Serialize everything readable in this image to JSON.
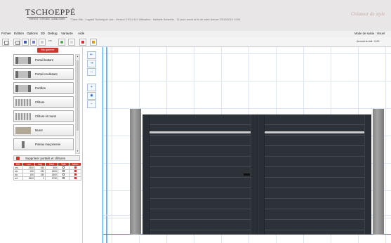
{
  "brand": {
    "logo": "TSCHOEPPÉ",
    "tagline": "PORTAILS · CLÔTURES · GARDE-CORPS",
    "watermark": "Créateur de style"
  },
  "title_bar": {
    "text": "\"Clara Site - Logiciel Tschoeppé Live - Version 2.53.4.410 Utilisateur : Nathalie Schaefer - 11 jours avant la fin de votre licence    23/10/2014 14:54"
  },
  "menu": {
    "items": [
      "Fichier",
      "Édition",
      "Options",
      "3D",
      "Debug",
      "Variante",
      "Aide"
    ],
    "entry_mode": "Mode de saisie : Visuel"
  },
  "toolbar": {
    "cm_label": "cm",
    "roof_label": "Arrondi du toit : 0,00"
  },
  "left_panel": {
    "tab_label": "Ma gamme",
    "families": [
      {
        "label": "Portail battant",
        "thumb": "thumb-gate"
      },
      {
        "label": "Portail coulissant",
        "thumb": "thumb-gate"
      },
      {
        "label": "Portillon",
        "thumb": "thumb-gate"
      },
      {
        "label": "Clôture",
        "thumb": "thumb-panel"
      },
      {
        "label": "Clôture et muret",
        "thumb": "thumb-panel"
      },
      {
        "label": "Muret",
        "thumb": "thumb-wall"
      },
      {
        "label": "Poteau maçonnerie",
        "thumb": "thumb-post"
      }
    ],
    "delete_label": "Supprimer portails et clôtures",
    "table": {
      "headers": [
        "Réf.",
        "Lon",
        "Larg",
        "Haut",
        "Visib",
        "Action"
      ],
      "rows": [
        [
          "ont.",
          "2300",
          "150",
          "800"
        ],
        [
          "clo.",
          "150",
          "150",
          "1800"
        ],
        [
          "clo.",
          "150",
          "150",
          "1800"
        ],
        [
          "ref.",
          "3500",
          "0",
          "1750"
        ]
      ]
    }
  },
  "tools": {
    "icons": [
      {
        "name": "align-left-icon",
        "glyph": "⇤"
      },
      {
        "name": "align-right-icon",
        "glyph": "⇥"
      },
      {
        "name": "spread-icon",
        "glyph": "↔"
      },
      {
        "name": "zoom-in-icon",
        "glyph": "+"
      },
      {
        "name": "zoom-fit-icon",
        "glyph": "◉"
      },
      {
        "name": "zoom-out-icon",
        "glyph": "−"
      }
    ]
  },
  "colors": {
    "accent_red": "#c7382a",
    "gate_color": "#2d3138",
    "grid_blue": "#dce5f3"
  }
}
